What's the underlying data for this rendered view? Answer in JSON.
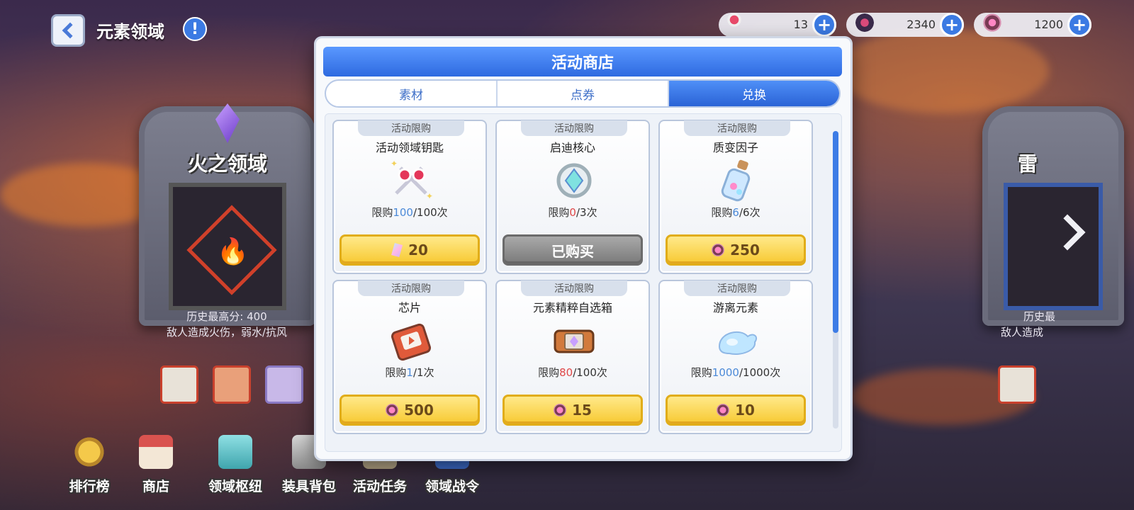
{
  "topbar": {
    "title": "元素领域",
    "help_symbol": "!",
    "currencies": [
      {
        "icon": "key-icon",
        "value": "13",
        "plus": "+"
      },
      {
        "icon": "ticket-icon",
        "value": "2340",
        "plus": "+"
      },
      {
        "icon": "element-coin-icon",
        "value": "1200",
        "plus": "+"
      }
    ]
  },
  "background": {
    "fire_gate": {
      "title": "火之领域",
      "best_score": "历史最高分: 400",
      "desc": "敌人造成火伤，弱水/抗风"
    },
    "thunder_gate": {
      "title": "雷",
      "best_score": "历史最",
      "desc": "敌人造成"
    }
  },
  "shop": {
    "title": "活动商店",
    "tabs": [
      {
        "label": "素材",
        "active": false
      },
      {
        "label": "点券",
        "active": false
      },
      {
        "label": "兑换",
        "active": true
      }
    ],
    "items": [
      {
        "tag": "活动限购",
        "name": "活动领域钥匙",
        "icon": "key-item-icon",
        "limit_prefix": "限购",
        "bought": "100",
        "limit_suffix": "/100次",
        "price": "20",
        "price_icon": "gem",
        "sold": false
      },
      {
        "tag": "活动限购",
        "name": "启迪核心",
        "icon": "core-item-icon",
        "limit_prefix": "限购",
        "bought": "0",
        "limit_suffix": "/3次",
        "price": "已购买",
        "price_icon": "none",
        "sold": true
      },
      {
        "tag": "活动限购",
        "name": "质变因子",
        "icon": "bottle-item-icon",
        "limit_prefix": "限购",
        "bought": "6",
        "limit_suffix": "/6次",
        "price": "250",
        "price_icon": "coin",
        "sold": false
      },
      {
        "tag": "活动限购",
        "name": "芯片",
        "icon": "chip-item-icon",
        "limit_prefix": "限购",
        "bought": "1",
        "limit_suffix": "/1次",
        "price": "500",
        "price_icon": "coin",
        "sold": false
      },
      {
        "tag": "活动限购",
        "name": "元素精粹自选箱",
        "icon": "box-item-icon",
        "limit_prefix": "限购",
        "bought": "80",
        "limit_suffix": "/100次",
        "price": "15",
        "price_icon": "coin",
        "sold": false
      },
      {
        "tag": "活动限购",
        "name": "游离元素",
        "icon": "slime-item-icon",
        "limit_prefix": "限购",
        "bought": "1000",
        "limit_suffix": "/1000次",
        "price": "10",
        "price_icon": "coin",
        "sold": false
      }
    ]
  },
  "nav": [
    {
      "label": "排行榜",
      "icon": "rank-medal-icon",
      "color": "#e8b32c"
    },
    {
      "label": "商店",
      "icon": "shop-icon",
      "color": "#d9534f"
    },
    {
      "label": "领域枢纽",
      "icon": "hub-icon",
      "color": "#4fc3c8"
    },
    {
      "label": "装具背包",
      "icon": "bag-icon",
      "color": "#b8b8b8"
    },
    {
      "label": "活动任务",
      "icon": "task-icon",
      "color": "#c8b89a"
    },
    {
      "label": "领域战令",
      "icon": "battle-pass-icon",
      "color": "#3f6fd0"
    }
  ]
}
